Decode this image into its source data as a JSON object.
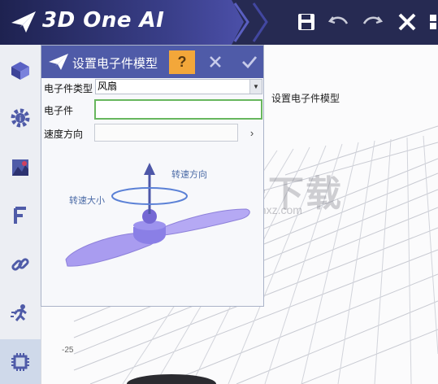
{
  "app": {
    "title": "3D One AI"
  },
  "dialog": {
    "title": "设置电子件模型",
    "help_label": "?",
    "fields": {
      "type_label": "电子件类型",
      "type_value": "风扇",
      "component_label": "电子件",
      "component_value": "",
      "direction_label": "速度方向",
      "direction_value": ""
    },
    "figure": {
      "direction_label": "转速方向",
      "magnitude_label": "转速大小"
    }
  },
  "viewport": {
    "label": "设置电子件模型",
    "axis_tick": "-25"
  },
  "watermark": {
    "main": "安下载",
    "sub": "anxz.com"
  },
  "colors": {
    "accent": "#4f5ba8",
    "title_bar": "#262a52",
    "help": "#f3a73a",
    "focus": "#68b75e",
    "fan": "#a99cf0"
  }
}
